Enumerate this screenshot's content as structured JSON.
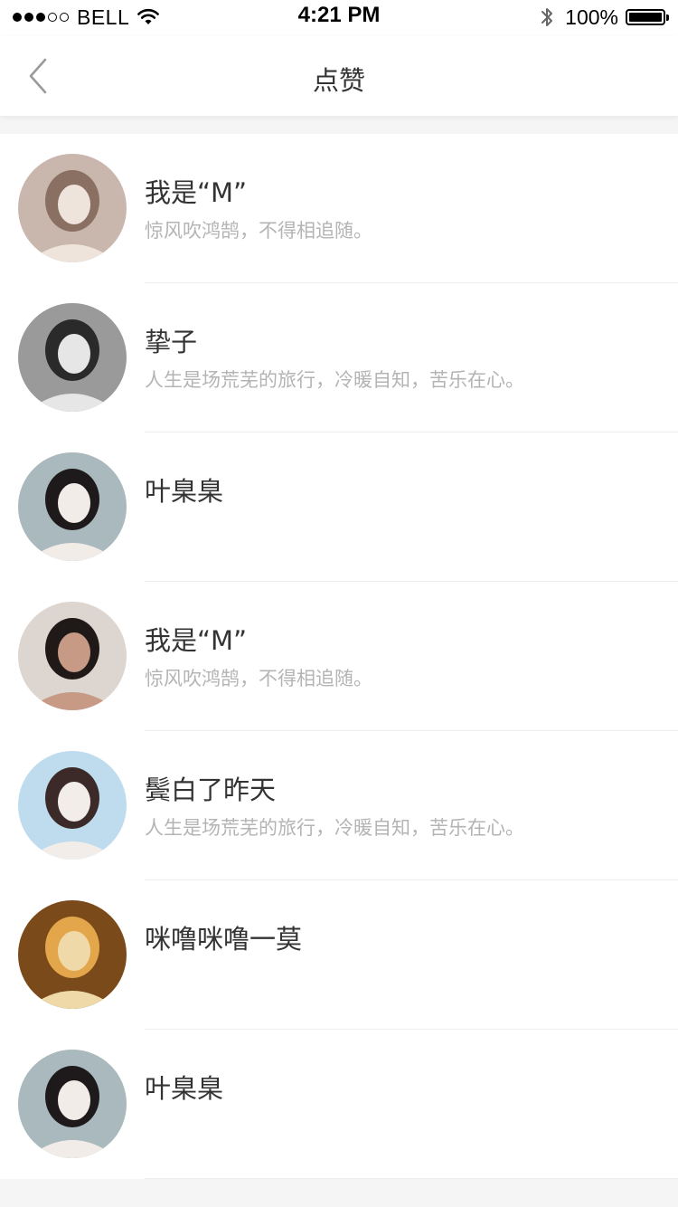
{
  "status_bar": {
    "signal_filled": 3,
    "signal_total": 5,
    "carrier": "BELL",
    "time": "4:21 PM",
    "battery_percent": "100%",
    "battery_level": 1.0
  },
  "nav": {
    "title": "点赞",
    "back_icon": "chevron-left-icon"
  },
  "likes": [
    {
      "name": "我是“M”",
      "desc": "惊风吹鸿鹄，不得相追随。",
      "avatar_palette": [
        "#c9b7ad",
        "#8a6f63",
        "#efe4dc"
      ]
    },
    {
      "name": "挚子",
      "desc": "人生是场荒芜的旅行，冷暖自知，苦乐在心。",
      "avatar_palette": [
        "#9a9a9a",
        "#2a2a2a",
        "#e6e6e6"
      ]
    },
    {
      "name": "叶臬臬",
      "desc": "",
      "avatar_palette": [
        "#a9b9bd",
        "#1e1a1c",
        "#f1ece8"
      ]
    },
    {
      "name": "我是“M”",
      "desc": "惊风吹鸿鹄，不得相追随。",
      "avatar_palette": [
        "#ddd6d0",
        "#1f1a18",
        "#c79a86"
      ]
    },
    {
      "name": "鬓白了昨天",
      "desc": "人生是场荒芜的旅行，冷暖自知，苦乐在心。",
      "avatar_palette": [
        "#bfdcef",
        "#3b2a28",
        "#f3ede9"
      ]
    },
    {
      "name": "咪噜咪噜一莫",
      "desc": "",
      "avatar_palette": [
        "#7a4a1a",
        "#e3a64a",
        "#f0d9a8"
      ]
    },
    {
      "name": "叶臬臬",
      "desc": "",
      "avatar_palette": [
        "#a9b9bd",
        "#1e1a1c",
        "#f1ece8"
      ]
    }
  ]
}
